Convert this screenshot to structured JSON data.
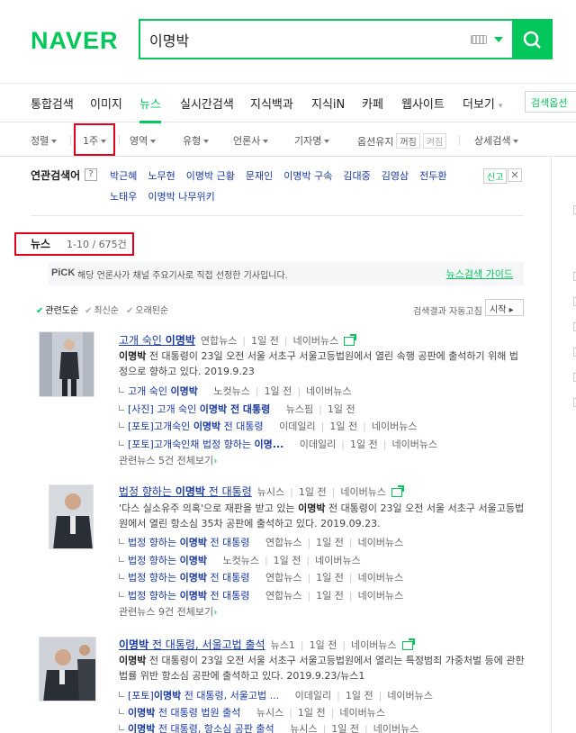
{
  "logo": "NAVER",
  "search": {
    "query": "이명박"
  },
  "nav": {
    "tabs": [
      "통합검색",
      "이미지",
      "뉴스",
      "실시간검색",
      "지식백과",
      "지식iN",
      "카페",
      "웹사이트"
    ],
    "more": "더보기",
    "options_button": "검색옵션"
  },
  "options": {
    "sort": "정렬",
    "period": "1주",
    "area": "영역",
    "type": "유형",
    "press": "언론사",
    "reporter": "기자명",
    "keep": "옵션유지",
    "keep_on": "꺼짐",
    "keep_off": "켜짐",
    "detail": "상세검색"
  },
  "related": {
    "label": "연관검색어",
    "help": "?",
    "row1": [
      "박근혜",
      "노무현",
      "이명박 근황",
      "문재인",
      "이명박 구속",
      "김대중",
      "김영삼",
      "전두환"
    ],
    "row2": [
      "노태우",
      "이명박 나무위키"
    ],
    "report": "신고",
    "close": "✕"
  },
  "news": {
    "title": "뉴스",
    "count": "1-10 / 675건",
    "pick_badge": "PiCK",
    "pick_text": "해당 언론사가 채널 주요기사로 직접 선정한 기사입니다.",
    "pick_guide": "뉴스검색 가이드",
    "sort_relevance": "관련도순",
    "sort_latest": "최신순",
    "sort_oldest": "오래된순",
    "auto_refresh": "검색결과 자동고침",
    "start": "시작 ▸",
    "items": [
      {
        "title_pre": "고개 숙인 ",
        "title_bold": "이명박",
        "title_post": "",
        "press": "연합뉴스",
        "time": "1일 전",
        "source": "네이버뉴스",
        "desc_bold": "이명박",
        "desc": " 전 대통령이 23일 오전 서울 서초구 서울고등법원에서 열린 속행 공판에 출석하기 위해 법정으로 향하고 있다. 2019.9.23",
        "subs": [
          {
            "pre": "고개 숙인 ",
            "bold": "이명박",
            "post": "",
            "press": "노컷뉴스",
            "time": "1일 전",
            "source": "네이버뉴스"
          },
          {
            "pre": "[사진] 고개 숙인 ",
            "bold": "이명박 전 대통령",
            "post": "",
            "press": "뉴스핌",
            "time": "1일 전",
            "source": ""
          },
          {
            "pre": "[포토]고개숙인 ",
            "bold": "이명박",
            "post": " 전 대통령",
            "press": "이데일리",
            "time": "1일 전",
            "source": "네이버뉴스"
          },
          {
            "pre": "[포토]고개숙인채 법정 향하는 ",
            "bold": "이명...",
            "post": "",
            "press": "이데일리",
            "time": "1일 전",
            "source": "네이버뉴스"
          }
        ],
        "more": "관련뉴스 5건 전체보기"
      },
      {
        "title_pre": "법정 향하는 ",
        "title_bold": "이명박",
        "title_post": " 전 대통령",
        "press": "뉴시스",
        "time": "1일 전",
        "source": "네이버뉴스",
        "desc_pre": "'다스 실소유주 의혹'으로 재판을 받고 있는 ",
        "desc_bold": "이명박",
        "desc": " 전 대통령이 23일 오전 서울 서초구 서울고등법원에서 열린 항소심 35차 공판에 출석하고 있다. 2019.09.23.",
        "subs": [
          {
            "pre": "법정 향하는 ",
            "bold": "이명박",
            "post": " 전 대통령",
            "press": "연합뉴스",
            "time": "1일 전",
            "source": "네이버뉴스"
          },
          {
            "pre": "법정 향하는 ",
            "bold": "이명박",
            "post": "",
            "press": "노컷뉴스",
            "time": "1일 전",
            "source": "네이버뉴스"
          },
          {
            "pre": "법정 향하는 ",
            "bold": "이명박",
            "post": " 전 대통령",
            "press": "연합뉴스",
            "time": "1일 전",
            "source": "네이버뉴스"
          },
          {
            "pre": "법정 향하는 ",
            "bold": "이명박",
            "post": " 전 대통령",
            "press": "연합뉴스",
            "time": "1일 전",
            "source": "네이버뉴스"
          }
        ],
        "more": "관련뉴스 9건 전체보기"
      },
      {
        "title_pre": "",
        "title_bold": "이명박",
        "title_post": " 전 대통령, 서울고법 출석",
        "press": "뉴스1",
        "time": "1일 전",
        "source": "네이버뉴스",
        "desc_bold": "이명박",
        "desc": " 전 대통령이 23일 오전 서울 서초구 서울고등법원에서 열리는 특정범죄 가중처벌 등에 관한 법률 위반 항소심 공판에 출석하고 있다. 2019.9.23/뉴스1",
        "subs": [
          {
            "pre": "[포토]",
            "bold": "이명박",
            "post": " 전 대통령, 서울고법 ...",
            "press": "이데일리",
            "time": "1일 전",
            "source": "네이버뉴스"
          },
          {
            "pre": "",
            "bold": "이명박",
            "post": " 전 대통령 법원 출석",
            "press": "뉴시스",
            "time": "1일 전",
            "source": "네이버뉴스"
          },
          {
            "pre": "",
            "bold": "이명박",
            "post": " 전 대통령, 항소심 공판 출석",
            "press": "뉴시스",
            "time": "1일 전",
            "source": "네이버뉴스"
          }
        ]
      }
    ]
  },
  "colors": {
    "brand": "#03c75a",
    "link": "#1b3aa0",
    "highlight": "#e1001e"
  }
}
